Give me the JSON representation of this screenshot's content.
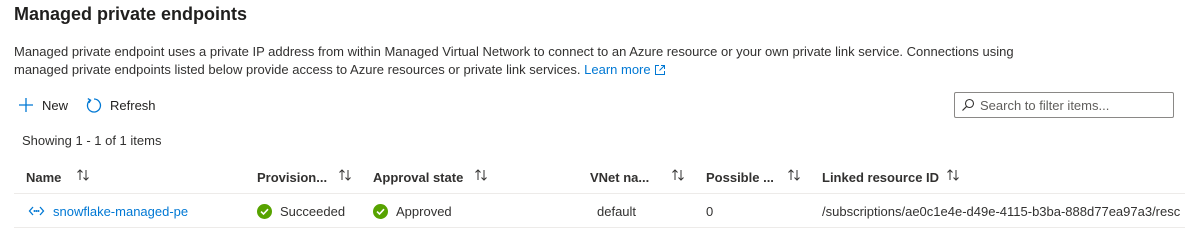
{
  "page": {
    "title": "Managed private endpoints",
    "description": "Managed private endpoint uses a private IP address from within Managed Virtual Network to connect to an Azure resource or your own private link service. Connections using managed private endpoints listed below provide access to Azure resources or private link services.",
    "learn_more": "Learn more"
  },
  "toolbar": {
    "new_label": "New",
    "refresh_label": "Refresh"
  },
  "search": {
    "placeholder": "Search to filter items..."
  },
  "status": {
    "showing": "Showing 1 - 1 of 1 items"
  },
  "table": {
    "columns": {
      "name": "Name",
      "provisioning": "Provision...",
      "approval": "Approval state",
      "vnet": "VNet na...",
      "possible": "Possible ...",
      "linked": "Linked resource ID"
    },
    "rows": [
      {
        "name": "snowflake-managed-pe",
        "provisioning": "Succeeded",
        "approval": "Approved",
        "vnet": "default",
        "possible": "0",
        "linked": "/subscriptions/ae0c1e4e-d49e-4115-b3ba-888d77ea97a3/resc"
      }
    ]
  },
  "colors": {
    "accent": "#0078d4",
    "success": "#57a300",
    "text": "#323130",
    "border": "#edebe9"
  },
  "icons": {
    "new": "plus-icon",
    "refresh": "refresh-icon",
    "search": "search-icon",
    "external": "external-link-icon",
    "sort": "sort-arrows-icon",
    "endpoint": "private-endpoint-icon",
    "status_ok": "check-circle-icon"
  }
}
